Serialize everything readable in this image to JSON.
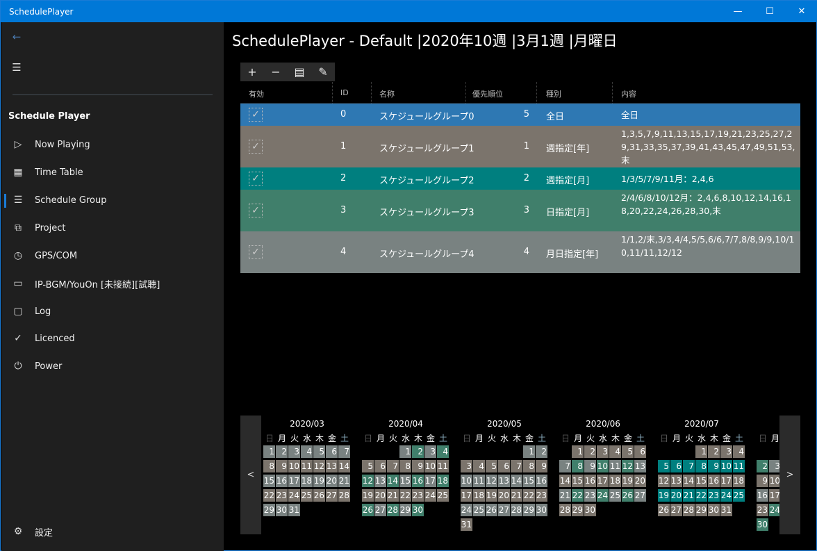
{
  "window": {
    "title": "SchedulePlayer",
    "controls": [
      "minimize",
      "maximize",
      "close"
    ]
  },
  "sidebar": {
    "section_title": "Schedule Player",
    "items": [
      {
        "label": "Now Playing",
        "icon": "play-icon",
        "glyph": "▷"
      },
      {
        "label": "Time Table",
        "icon": "calendar-icon",
        "glyph": "▦"
      },
      {
        "label": "Schedule Group",
        "icon": "list-icon",
        "glyph": "☰",
        "selected": true
      },
      {
        "label": "Project",
        "icon": "windows-icon",
        "glyph": "⧉"
      },
      {
        "label": "GPS/COM",
        "icon": "clock-icon",
        "glyph": "◷"
      },
      {
        "label": "IP-BGM/YouOn [未接続][試聴]",
        "icon": "monitor-icon",
        "glyph": "▭"
      },
      {
        "label": "Log",
        "icon": "message-icon",
        "glyph": "▢"
      },
      {
        "label": "Licenced",
        "icon": "check-icon",
        "glyph": "✓"
      },
      {
        "label": "Power",
        "icon": "power-icon",
        "glyph": "⏻"
      }
    ],
    "settings_label": "設定"
  },
  "main": {
    "title": "SchedulePlayer - Default |2020年10週 |3月1週 |月曜日",
    "toolbar": [
      {
        "icon": "add-icon",
        "glyph": "+"
      },
      {
        "icon": "remove-icon",
        "glyph": "−"
      },
      {
        "icon": "copy-icon",
        "glyph": "▤"
      },
      {
        "icon": "edit-icon",
        "glyph": "✎"
      }
    ],
    "columns": [
      "有効",
      "ID",
      "名称",
      "優先順位",
      "種別",
      "内容"
    ],
    "rows": [
      {
        "enabled": true,
        "id": "0",
        "name": "スケジュールグループ0",
        "priority": "5",
        "type": "全日",
        "content": "全日",
        "color": "#2e78b3"
      },
      {
        "enabled": true,
        "id": "1",
        "name": "スケジュールグループ1",
        "priority": "1",
        "type": "週指定[年]",
        "content": "1,3,5,7,9,11,13,15,17,19,21,23,25,27,29,31,33,35,37,39,41,43,45,47,49,51,53,末",
        "color": "#7b746c"
      },
      {
        "enabled": true,
        "id": "2",
        "name": "スケジュールグループ2",
        "priority": "2",
        "type": "週指定[月]",
        "content": "1/3/5/7/9/11月：2,4,6",
        "color": "#007f7f"
      },
      {
        "enabled": true,
        "id": "3",
        "name": "スケジュールグループ3",
        "priority": "3",
        "type": "日指定[月]",
        "content": "2/4/6/8/10/12月：2,4,6,8,10,12,14,16,18,20,22,24,26,28,30,末",
        "color": "#407f6b"
      },
      {
        "enabled": true,
        "id": "4",
        "name": "スケジュールグループ4",
        "priority": "4",
        "type": "月日指定[年]",
        "content": "1/1,2/末,3/3,4/4,5/5,6/6,7/7,8/8,9/9,10/10,11/11,12/12",
        "color": "#798281"
      }
    ]
  },
  "calendar": {
    "prev_label": "<",
    "next_label": ">",
    "weekdays": [
      "日",
      "月",
      "火",
      "水",
      "木",
      "金",
      "土"
    ],
    "colors": {
      "G": "#798281",
      "B": "#7b746c",
      "E": "#407f6b",
      "T": "#007f7f"
    },
    "months": [
      {
        "label": "2020/03",
        "start": 0,
        "days": "GGGGGGGBBBBBBBGGGGGGGBBBBBBBGGG"
      },
      {
        "label": "2020/04",
        "start": 3,
        "days": "GEGEBBBBBBBEGEGEGEBBBBBBBEGEGE"
      },
      {
        "label": "2020/05",
        "start": 5,
        "days": "GGBBBBBBBGGGGGGGBBBBBBBGGGGGGGB"
      },
      {
        "label": "2020/06",
        "start": 1,
        "days": "BBBBBBGEGEGEGBBBBBBBGEGEGEGBBB"
      },
      {
        "label": "2020/07",
        "start": 3,
        "days": "BBBBTTTTTTTBBBBBBBTTTTTTTBBBBBB"
      },
      {
        "label": "",
        "start": 6,
        "days": "BEGBBBBBBBEGEGEGBBBBBBBEGEGEGE"
      }
    ]
  }
}
